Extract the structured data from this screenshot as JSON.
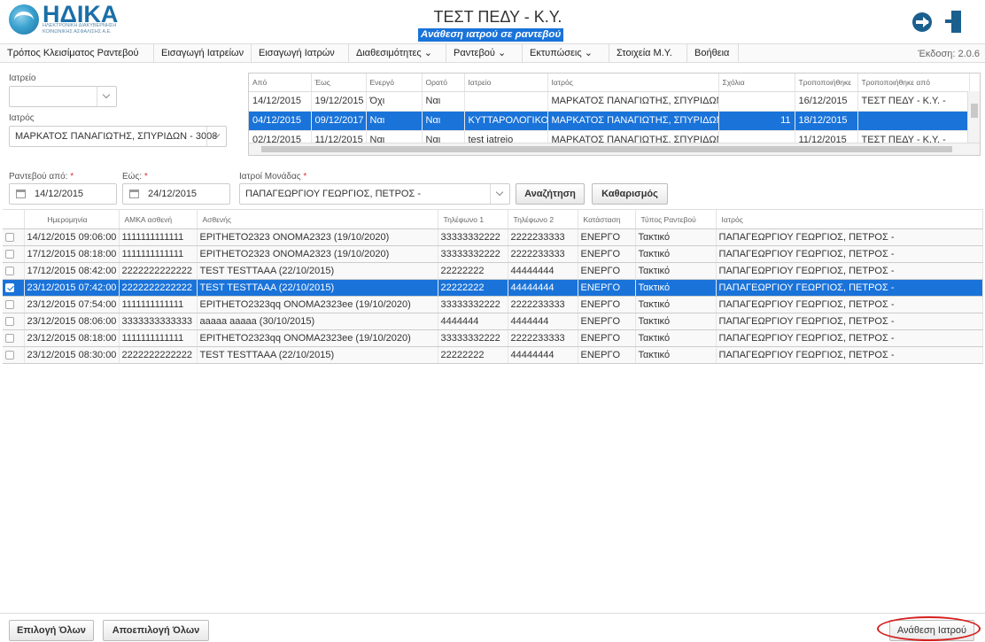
{
  "header": {
    "logo_name": "ΗΔΙΚΑ",
    "logo_sub1": "ΗΛΕΚΤΡΟΝΙΚΗ ΔΙΑΚΥΒΕΡΝΗΣΗ",
    "logo_sub2": "ΚΟΙΝΩΝΙΚΗΣ ΑΣΦΑΛΙΣΗΣ Α.Ε.",
    "title": "ΤΕΣΤ ΠΕΔΥ - Κ.Υ.",
    "subtitle": "Ανάθεση ιατρού σε ραντεβού",
    "icons": [
      "switch-arrow-icon",
      "logout-door-icon"
    ]
  },
  "menu": {
    "items": [
      {
        "label": "Τρόπος Κλεισίματος Ραντεβού"
      },
      {
        "label": "Εισαγωγή Ιατρείων"
      },
      {
        "label": "Εισαγωγή Ιατρών"
      },
      {
        "label": "Διαθεσιμότητες ⌄"
      },
      {
        "label": "Ραντεβού ⌄"
      },
      {
        "label": "Εκτυπώσεις ⌄"
      },
      {
        "label": "Στοιχεία Μ.Υ."
      },
      {
        "label": "Βοήθεια"
      }
    ],
    "version": "Έκδοση: 2.0.6"
  },
  "filters": {
    "iatreio_label": "Ιατρείο",
    "iatreio_value": "",
    "iatros_label": "Ιατρός",
    "iatros_value": "ΜΑΡΚΑΤΟΣ ΠΑΝΑΓΙΩΤΗΣ, ΣΠΥΡΙΔΩΝ - 3008"
  },
  "upper_grid": {
    "columns": [
      "Από",
      "Έως",
      "Ενεργό",
      "Ορατό",
      "Ιατρείο",
      "Ιατρός",
      "Σχόλια",
      "Τροποποιήθηκε",
      "Τροποποιήθηκε από"
    ],
    "rows": [
      {
        "from": "14/12/2015",
        "to": "19/12/2015",
        "active": "Όχι",
        "visible": "Ναι",
        "clinic": "",
        "doctor": "ΜΑΡΚΑΤΟΣ ΠΑΝΑΓΙΩΤΗΣ, ΣΠΥΡΙΔΩΝ",
        "comments": "",
        "modified": "16/12/2015",
        "modified_by": "ΤΕΣΤ ΠΕΔΥ - Κ.Υ. -",
        "selected": false
      },
      {
        "from": "04/12/2015",
        "to": "09/12/2017",
        "active": "Ναι",
        "visible": "Ναι",
        "clinic": "ΚΥΤΤΑΡΟΛΟΓΙΚΟ",
        "doctor": "ΜΑΡΚΑΤΟΣ ΠΑΝΑΓΙΩΤΗΣ, ΣΠΥΡΙΔΩΝ",
        "comments": "11",
        "modified": "18/12/2015",
        "modified_by": "",
        "selected": true
      },
      {
        "from": "02/12/2015",
        "to": "11/12/2015",
        "active": "Ναι",
        "visible": "Ναι",
        "clinic": "test iatreio",
        "doctor": "ΜΑΡΚΑΤΟΣ ΠΑΝΑΓΙΩΤΗΣ, ΣΠΥΡΙΔΩΝ",
        "comments": "",
        "modified": "11/12/2015",
        "modified_by": "ΤΕΣΤ ΠΕΔΥ - Κ.Υ. -",
        "selected": false
      }
    ]
  },
  "search": {
    "from_label": "Ραντεβού από:",
    "from_value": "14/12/2015",
    "to_label": "Εώς:",
    "to_value": "24/12/2015",
    "unit_doctors_label": "Ιατροί Μονάδας",
    "unit_doctors_value": "ΠΑΠΑΓΕΩΡΓΙΟΥ ΓΕΩΡΓΙΟΣ, ΠΕΤΡΟΣ -",
    "search_button": "Αναζήτηση",
    "clear_button": "Καθαρισμός"
  },
  "main_grid": {
    "columns": [
      "Ημερομηνία",
      "ΑΜΚΑ ασθενή",
      "Ασθενής",
      "Τηλέφωνο 1",
      "Τηλέφωνο 2",
      "Κατάσταση",
      "Τύπος Ραντεβού",
      "Ιατρός"
    ],
    "rows": [
      {
        "date": "14/12/2015 09:06:00",
        "amka": "1111111111111",
        "patient": "EPITHETO2323 ONOMA2323 (19/10/2020)",
        "phone1": "33333332222",
        "phone2": "2222233333",
        "status": "ΕΝΕΡΓΟ",
        "type": "Τακτικό",
        "doctor": "ΠΑΠΑΓΕΩΡΓΙΟΥ ΓΕΩΡΓΙΟΣ, ΠΕΤΡΟΣ -",
        "selected": false
      },
      {
        "date": "17/12/2015 08:18:00",
        "amka": "1111111111111",
        "patient": "EPITHETO2323 ONOMA2323 (19/10/2020)",
        "phone1": "33333332222",
        "phone2": "2222233333",
        "status": "ΕΝΕΡΓΟ",
        "type": "Τακτικό",
        "doctor": "ΠΑΠΑΓΕΩΡΓΙΟΥ ΓΕΩΡΓΙΟΣ, ΠΕΤΡΟΣ -",
        "selected": false
      },
      {
        "date": "17/12/2015 08:42:00",
        "amka": "2222222222222",
        "patient": "TEST TESTTAAA (22/10/2015)",
        "phone1": "22222222",
        "phone2": "44444444",
        "status": "ΕΝΕΡΓΟ",
        "type": "Τακτικό",
        "doctor": "ΠΑΠΑΓΕΩΡΓΙΟΥ ΓΕΩΡΓΙΟΣ, ΠΕΤΡΟΣ -",
        "selected": false
      },
      {
        "date": "23/12/2015 07:42:00",
        "amka": "2222222222222",
        "patient": "TEST TESTTAAA (22/10/2015)",
        "phone1": "22222222",
        "phone2": "44444444",
        "status": "ΕΝΕΡΓΟ",
        "type": "Τακτικό",
        "doctor": "ΠΑΠΑΓΕΩΡΓΙΟΥ ΓΕΩΡΓΙΟΣ, ΠΕΤΡΟΣ -",
        "selected": true
      },
      {
        "date": "23/12/2015 07:54:00",
        "amka": "1111111111111",
        "patient": "EPITHETO2323qq ONOMA2323ee (19/10/2020)",
        "phone1": "33333332222",
        "phone2": "2222233333",
        "status": "ΕΝΕΡΓΟ",
        "type": "Τακτικό",
        "doctor": "ΠΑΠΑΓΕΩΡΓΙΟΥ ΓΕΩΡΓΙΟΣ, ΠΕΤΡΟΣ -",
        "selected": false
      },
      {
        "date": "23/12/2015 08:06:00",
        "amka": "3333333333333",
        "patient": "aaaaa aaaaa (30/10/2015)",
        "phone1": "4444444",
        "phone2": "4444444",
        "status": "ΕΝΕΡΓΟ",
        "type": "Τακτικό",
        "doctor": "ΠΑΠΑΓΕΩΡΓΙΟΥ ΓΕΩΡΓΙΟΣ, ΠΕΤΡΟΣ -",
        "selected": false
      },
      {
        "date": "23/12/2015 08:18:00",
        "amka": "1111111111111",
        "patient": "EPITHETO2323qq ONOMA2323ee (19/10/2020)",
        "phone1": "33333332222",
        "phone2": "2222233333",
        "status": "ΕΝΕΡΓΟ",
        "type": "Τακτικό",
        "doctor": "ΠΑΠΑΓΕΩΡΓΙΟΥ ΓΕΩΡΓΙΟΣ, ΠΕΤΡΟΣ -",
        "selected": false
      },
      {
        "date": "23/12/2015 08:30:00",
        "amka": "2222222222222",
        "patient": "TEST TESTTAAA (22/10/2015)",
        "phone1": "22222222",
        "phone2": "44444444",
        "status": "ΕΝΕΡΓΟ",
        "type": "Τακτικό",
        "doctor": "ΠΑΠΑΓΕΩΡΓΙΟΥ ΓΕΩΡΓΙΟΣ, ΠΕΤΡΟΣ -",
        "selected": false
      }
    ]
  },
  "footer": {
    "select_all": "Επιλογή Όλων",
    "deselect_all": "Αποεπιλογή Όλων",
    "assign_doctor": "Ανάθεση Ιατρού"
  },
  "colors": {
    "selection": "#1a73d9",
    "brand": "#1a6fa8",
    "highlight_annotation": "#d61f1f"
  }
}
